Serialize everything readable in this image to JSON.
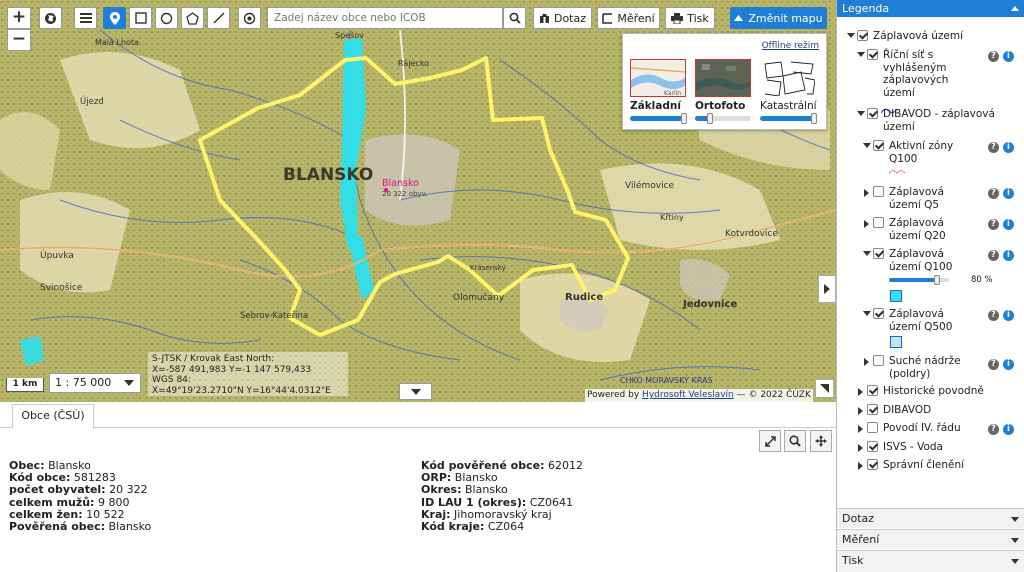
{
  "toolbar": {
    "zoom_in": "+",
    "zoom_out": "−",
    "search_placeholder": "Zadej název obce nebo ICOB",
    "query_label": "Dotaz",
    "measure_label": "Měření",
    "print_label": "Tisk",
    "change_map_label": "Změnit mapu"
  },
  "basemap_panel": {
    "offline_label": "Offline režim",
    "maps": [
      {
        "label": "Základní",
        "thumb_text": "Karlín",
        "selected": true
      },
      {
        "label": "Ortofoto",
        "selected": false
      },
      {
        "label": "Katastrální",
        "selected": false
      }
    ]
  },
  "map": {
    "town_label": "BLANSKO",
    "marker_label": "Blansko",
    "marker_sub": "20 322 obyv.",
    "coords": {
      "line1": "S-JTSK / Krovak East North:",
      "line2": "X=-587 491,983 Y=-1 147 579,433",
      "line3": "WGS 84:",
      "line4": "X=49°19'23.2710\"N Y=16°44'4.0312\"E"
    },
    "scale_bar": "1 km",
    "scale_value": "1 : 75 000",
    "attribution_prefix": "Powered by",
    "attribution_link": "Hydrosoft Veleslavín",
    "attribution_suffix": " — © 2022 ČÚZK",
    "place_labels": [
      "Spešov",
      "Rájecko",
      "Malá Lhota",
      "Blansko",
      "Olomučany",
      "Rudice",
      "Jedovnice",
      "Křtiny",
      "Vilémovice",
      "Kotvrdovice",
      "Úpuvka",
      "Svinošice",
      "Sebrov-Kateřina",
      "Krásenský",
      "CHKO MORAVSKÝ KRAS",
      "Újezd"
    ]
  },
  "bottom": {
    "tab_label": "Obce (ČSÚ)",
    "left": [
      {
        "k": "Obec:",
        "v": "Blansko"
      },
      {
        "k": "Kód obce:",
        "v": "581283"
      },
      {
        "k": "počet obyvatel:",
        "v": "20 322"
      },
      {
        "k": "celkem mužů:",
        "v": "9 800"
      },
      {
        "k": "celkem žen:",
        "v": "10 522"
      },
      {
        "k": "Pověřená obec:",
        "v": "Blansko"
      }
    ],
    "right": [
      {
        "k": "Kód pověřené obce:",
        "v": "62012"
      },
      {
        "k": "ORP:",
        "v": "Blansko"
      },
      {
        "k": "Okres:",
        "v": "Blansko"
      },
      {
        "k": "ID LAU 1 (okres):",
        "v": "CZ0641"
      },
      {
        "k": "Kraj:",
        "v": "Jihomoravský kraj"
      },
      {
        "k": "Kód kraje:",
        "v": "CZ064"
      }
    ]
  },
  "legend": {
    "title": "Legenda",
    "items": [
      {
        "label": "Záplavová území"
      },
      {
        "label": "Říční síť s vyhlášeným záplavových území"
      },
      {
        "label": "DIBAVOD - záplavová území"
      },
      {
        "label": "Aktivní zóny Q100"
      },
      {
        "label": "Záplavová území Q5"
      },
      {
        "label": "Záplavová území Q20"
      },
      {
        "label": "Záplavová území Q100"
      },
      {
        "label": "Záplavová území Q500"
      },
      {
        "label": "Suché nádrže (poldry)"
      },
      {
        "label": "Historické povodně"
      },
      {
        "label": "DIBAVOD"
      },
      {
        "label": "Povodí IV. řádu"
      },
      {
        "label": "ISVS - Voda"
      },
      {
        "label": "Správní členění"
      }
    ],
    "opacity_label": "80 %",
    "opacity": 0.8,
    "sections": [
      "Dotaz",
      "Měření",
      "Tisk"
    ]
  },
  "colors": {
    "accent": "#1f7fd6",
    "boundary": "#fff36a",
    "water": "#2de0ec"
  }
}
